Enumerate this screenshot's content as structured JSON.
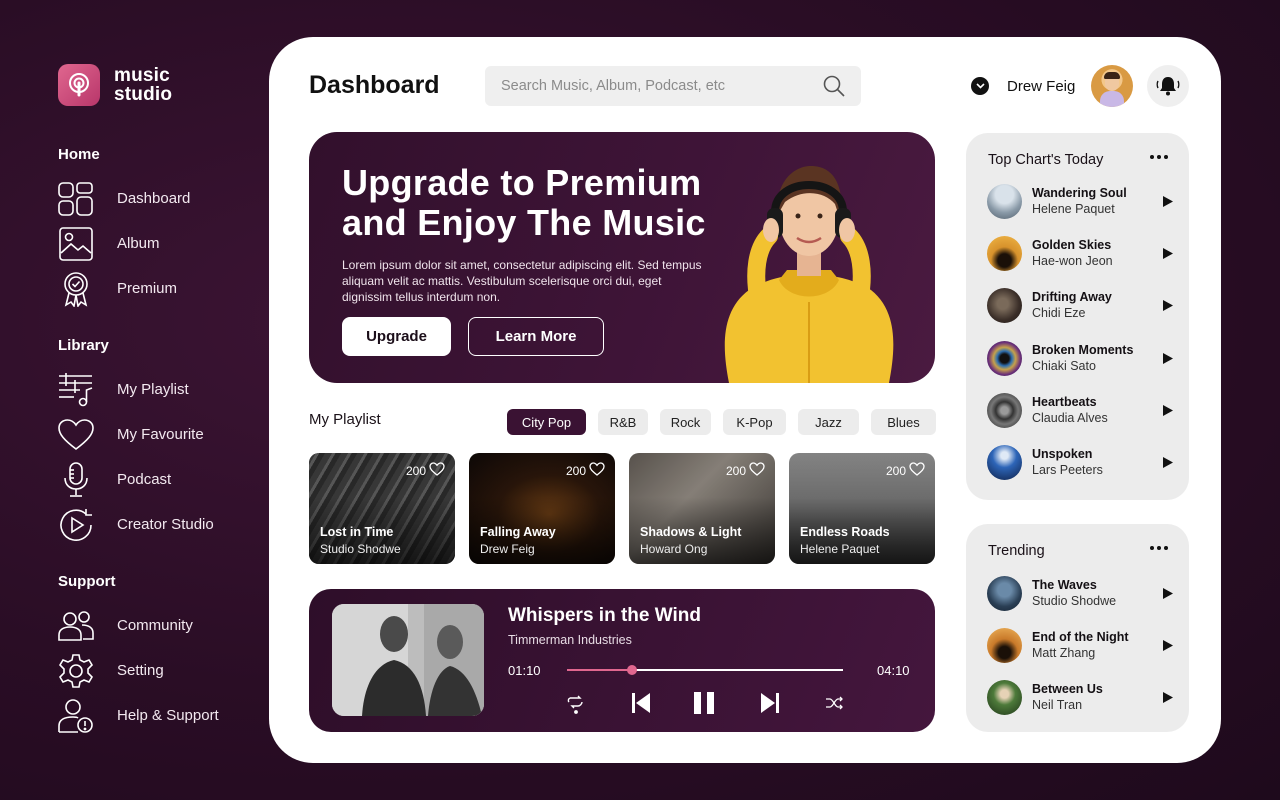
{
  "brand": {
    "line1": "music",
    "line2": "studio"
  },
  "sidebar": {
    "sections": [
      {
        "heading": "Home",
        "items": [
          {
            "label": "Dashboard",
            "icon": "dashboard-icon"
          },
          {
            "label": "Album",
            "icon": "album-icon"
          },
          {
            "label": "Premium",
            "icon": "premium-badge-icon"
          }
        ]
      },
      {
        "heading": "Library",
        "items": [
          {
            "label": "My Playlist",
            "icon": "playlist-icon"
          },
          {
            "label": "My Favourite",
            "icon": "heart-icon"
          },
          {
            "label": "Podcast",
            "icon": "microphone-icon"
          },
          {
            "label": "Creator Studio",
            "icon": "creator-play-icon"
          }
        ]
      },
      {
        "heading": "Support",
        "items": [
          {
            "label": "Community",
            "icon": "community-icon"
          },
          {
            "label": "Setting",
            "icon": "gear-icon"
          },
          {
            "label": "Help & Support",
            "icon": "help-user-icon"
          }
        ]
      }
    ]
  },
  "header": {
    "title": "Dashboard",
    "search_placeholder": "Search Music, Album, Podcast, etc",
    "username": "Drew Feig"
  },
  "banner": {
    "title_line1": "Upgrade to Premium",
    "title_line2": "and Enjoy The Music",
    "text": "Lorem ipsum dolor sit amet, consectetur adipiscing elit. Sed tempus aliquam velit ac mattis. Vestibulum scelerisque orci dui, eget dignissim tellus interdum non.",
    "primary_button": "Upgrade",
    "secondary_button": "Learn More"
  },
  "playlist": {
    "title": "My Playlist",
    "genres": [
      "City Pop",
      "R&B",
      "Rock",
      "K-Pop",
      "Jazz",
      "Blues"
    ],
    "active_genre": "City Pop",
    "cards": [
      {
        "title": "Lost in Time",
        "artist": "Studio Shodwe",
        "likes": "200"
      },
      {
        "title": "Falling Away",
        "artist": "Drew Feig",
        "likes": "200"
      },
      {
        "title": "Shadows & Light",
        "artist": "Howard Ong",
        "likes": "200"
      },
      {
        "title": "Endless Roads",
        "artist": "Helene Paquet",
        "likes": "200"
      }
    ]
  },
  "player": {
    "title": "Whispers in the Wind",
    "artist": "Timmerman Industries",
    "current_time": "01:10",
    "total_time": "04:10",
    "progress": 0.236,
    "accent": "#e0678f"
  },
  "top_charts": {
    "title": "Top Chart's Today",
    "items": [
      {
        "title": "Wandering Soul",
        "artist": "Helene Paquet"
      },
      {
        "title": "Golden Skies",
        "artist": "Hae-won Jeon"
      },
      {
        "title": "Drifting Away",
        "artist": "Chidi Eze"
      },
      {
        "title": "Broken Moments",
        "artist": "Chiaki Sato"
      },
      {
        "title": "Heartbeats",
        "artist": "Claudia Alves"
      },
      {
        "title": "Unspoken",
        "artist": "Lars Peeters"
      }
    ]
  },
  "trending": {
    "title": "Trending",
    "items": [
      {
        "title": "The Waves",
        "artist": "Studio Shodwe"
      },
      {
        "title": "End of the Night",
        "artist": "Matt Zhang"
      },
      {
        "title": "Between Us",
        "artist": "Neil Tran"
      }
    ]
  }
}
